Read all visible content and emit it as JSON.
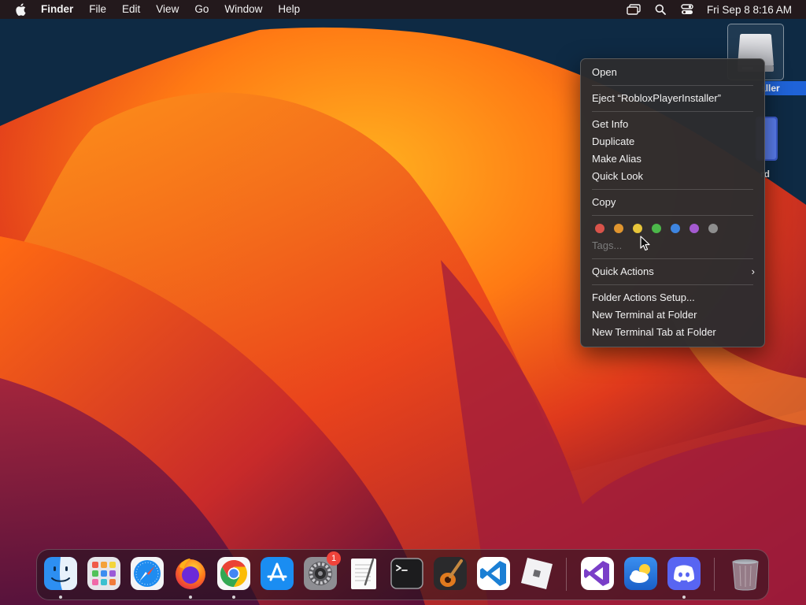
{
  "menubar": {
    "app_name": "Finder",
    "menus": [
      "File",
      "Edit",
      "View",
      "Go",
      "Window",
      "Help"
    ],
    "status_icons": [
      "screen-mirroring-icon",
      "search-icon",
      "control-center-icon"
    ],
    "clock": "Fri Sep 8  8:16 AM"
  },
  "desktop": {
    "drive_label": "RobloxPlayerInstaller",
    "drive2_label": "rd"
  },
  "context_menu": {
    "open": "Open",
    "eject": "Eject “RobloxPlayerInstaller”",
    "get_info": "Get Info",
    "duplicate": "Duplicate",
    "make_alias": "Make Alias",
    "quick_look": "Quick Look",
    "copy": "Copy",
    "tag_colors": [
      "#d9534a",
      "#e0952f",
      "#e7c53a",
      "#4cb84a",
      "#3e85e0",
      "#a45ad0",
      "#8e8e8e"
    ],
    "tags": "Tags...",
    "quick_actions": "Quick Actions",
    "submenu_chevron": "›",
    "folder_actions": "Folder Actions Setup...",
    "new_terminal": "New Terminal at Folder",
    "new_terminal_tab": "New Terminal Tab at Folder"
  },
  "dock": {
    "apps": [
      {
        "name": "finder-icon",
        "running": true
      },
      {
        "name": "launchpad-icon",
        "running": false
      },
      {
        "name": "safari-icon",
        "running": false
      },
      {
        "name": "firefox-icon",
        "running": true
      },
      {
        "name": "chrome-icon",
        "running": true
      },
      {
        "name": "app-store-icon",
        "running": false
      },
      {
        "name": "system-settings-icon",
        "running": false,
        "badge": "1"
      },
      {
        "name": "textedit-icon",
        "running": false
      },
      {
        "name": "terminal-icon",
        "running": false
      },
      {
        "name": "garageband-icon",
        "running": false
      },
      {
        "name": "vscode-icon",
        "running": false
      },
      {
        "name": "roblox-icon",
        "running": false
      },
      {
        "name": "visual-studio-icon",
        "running": false
      },
      {
        "name": "weather-icon",
        "running": false
      },
      {
        "name": "discord-icon",
        "running": true
      },
      {
        "name": "trash-icon",
        "running": false
      }
    ],
    "settings_badge": "1"
  }
}
